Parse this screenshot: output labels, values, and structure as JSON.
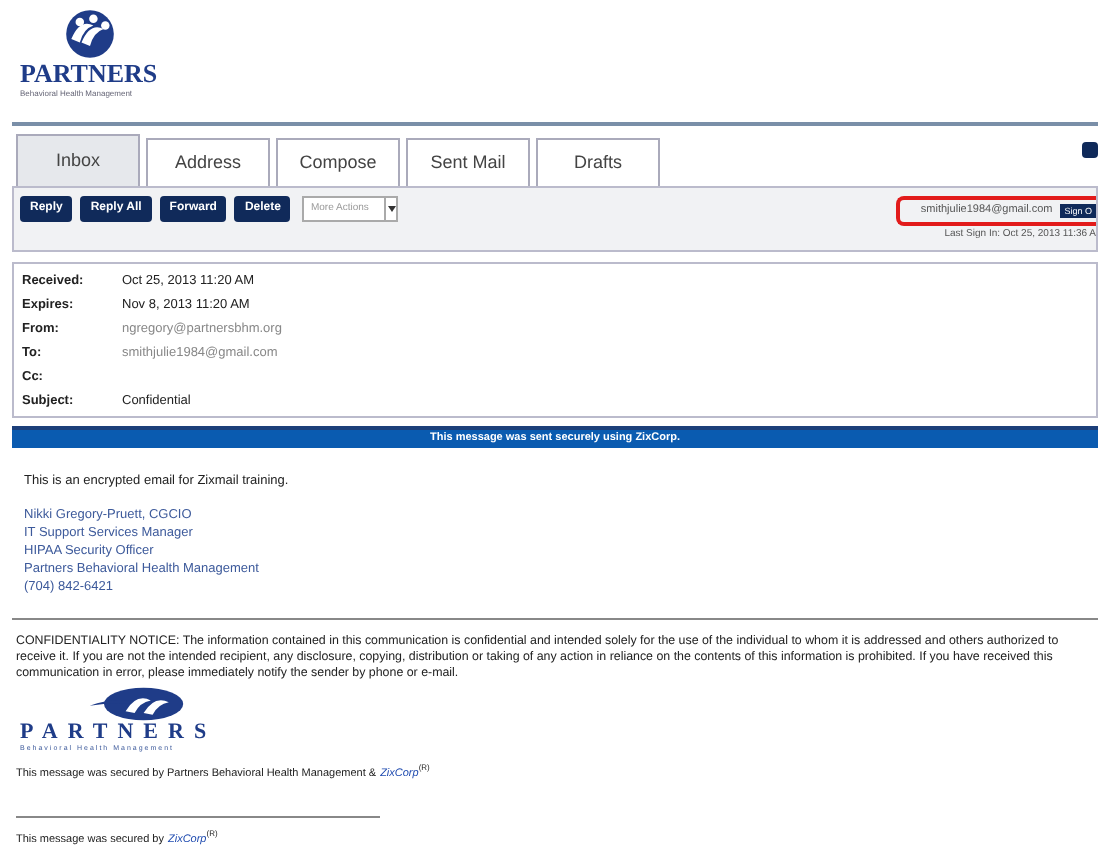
{
  "logo": {
    "name": "PARTNERS",
    "tagline": "Behavioral Health Management"
  },
  "tabs": [
    {
      "label": "Inbox",
      "selected": true
    },
    {
      "label": "Address",
      "selected": false
    },
    {
      "label": "Compose",
      "selected": false
    },
    {
      "label": "Sent Mail",
      "selected": false
    },
    {
      "label": "Drafts",
      "selected": false
    }
  ],
  "toolbar": {
    "buttons": [
      "Reply",
      "Reply All",
      "Forward",
      "Delete"
    ],
    "more_actions": "More Actions"
  },
  "account": {
    "email": "smithjulie1984@gmail.com",
    "sign_out": "Sign O",
    "last_sign_in": "Last Sign In: Oct 25, 2013 11:36 A",
    "highlighted": true
  },
  "headers": [
    {
      "label": "Received:",
      "value": "Oct 25, 2013 11:20 AM",
      "kind": "dark"
    },
    {
      "label": "Expires:",
      "value": "Nov 8, 2013 11:20 AM",
      "kind": "dark"
    },
    {
      "label": "From:",
      "value": "ngregory@partnersbhm.org",
      "kind": "light"
    },
    {
      "label": "To:",
      "value": "smithjulie1984@gmail.com",
      "kind": "light"
    },
    {
      "label": "Cc:"
    },
    {
      "label": "Subject:",
      "value": "Confidential",
      "kind": "dark"
    }
  ],
  "banner": "This message was sent securely using ZixCorp.",
  "body": "This is an encrypted email for Zixmail training.",
  "signature": [
    "Nikki Gregory-Pruett, CGCIO",
    "IT Support Services Manager",
    "HIPAA Security Officer",
    "Partners Behavioral Health Management",
    "(704) 842-6421"
  ],
  "notice": "CONFIDENTIALITY NOTICE: The information contained in this communication is confidential and intended solely for the use of the individual to whom it is addressed and others authorized to receive it. If you are not the intended recipient, any disclosure, copying, distribution or taking of any action in reliance on the contents of this information is prohibited. If you have received this communication in error, please immediately notify the sender by phone or e-mail.",
  "footer_logo": {
    "name": "PARTNERS",
    "tagline": "Behavioral Health Management"
  },
  "secured_lines": [
    {
      "text": "This message was secured by Partners Behavioral Health Management &",
      "link": "ZixCorp",
      "mark": "(R)"
    },
    {
      "text": "This message was secured by",
      "link": "ZixCorp",
      "mark": "(R)"
    }
  ]
}
